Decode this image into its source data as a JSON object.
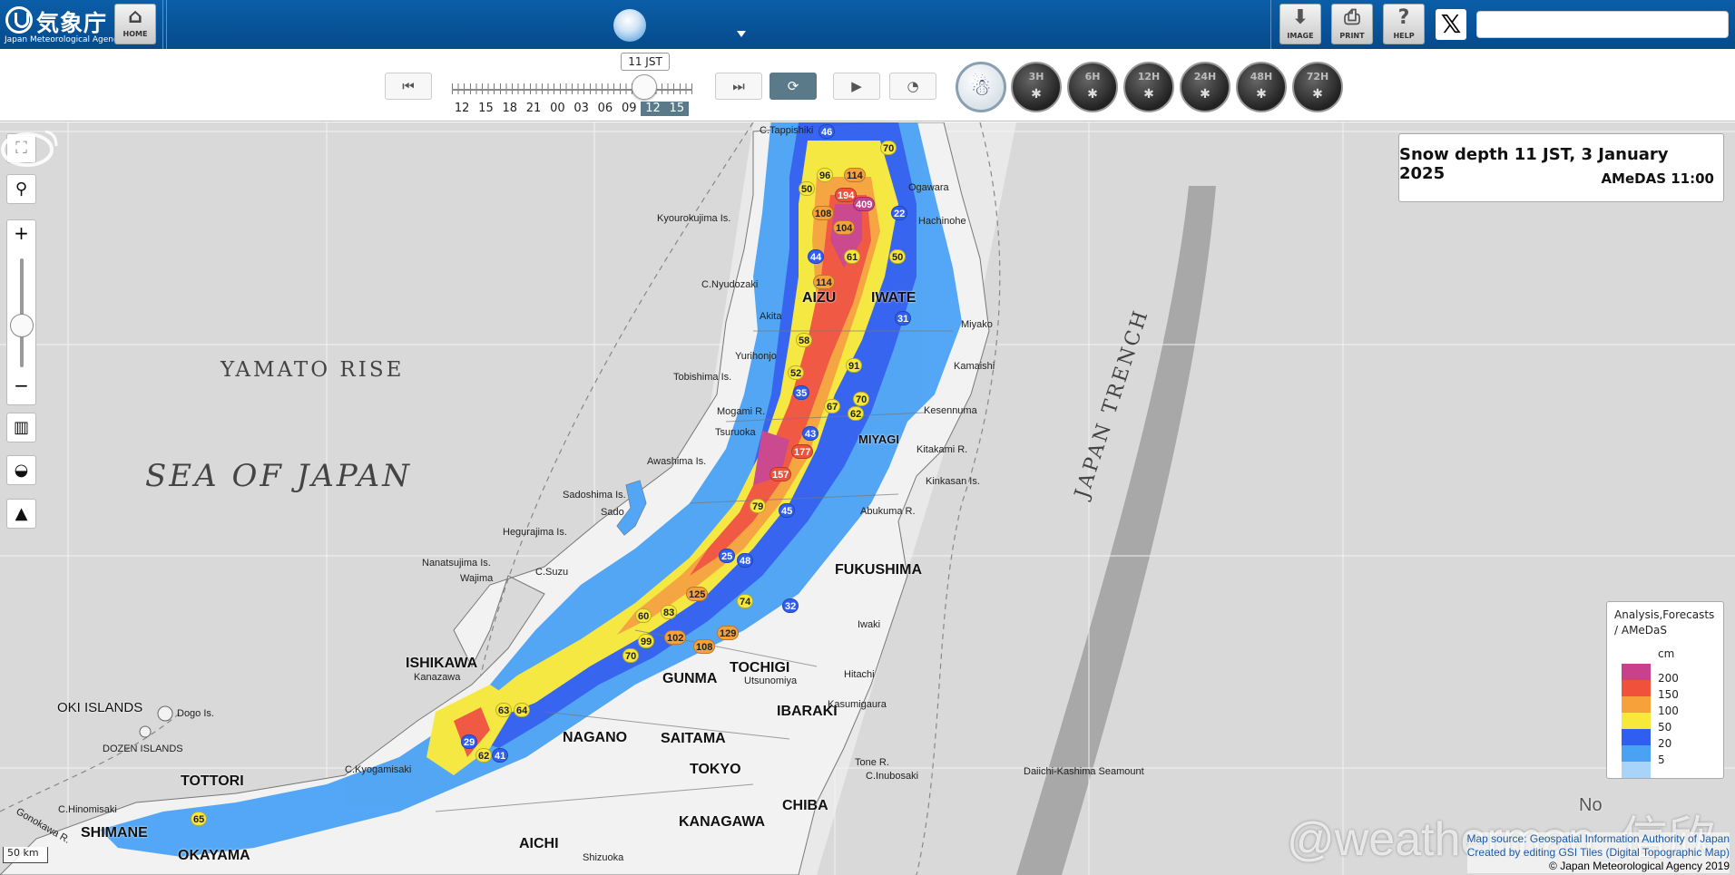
{
  "header": {
    "logo_jp": "気象庁",
    "logo_en": "Japan Meteorological Agency",
    "home_label": "HOME",
    "image_label": "IMAGE",
    "print_label": "PRINT",
    "help_label": "HELP",
    "x_label": "𝕏",
    "search_value": ""
  },
  "controls": {
    "time_tooltip": "11 JST",
    "hour_labels": [
      "12",
      "15",
      "18",
      "21",
      "00",
      "03",
      "06",
      "09",
      "12",
      "15"
    ],
    "highlighted_hours": [
      8,
      9
    ],
    "period_buttons": [
      "3H",
      "6H",
      "12H",
      "24H",
      "48H",
      "72H"
    ]
  },
  "info_box": {
    "line1": "Snow depth   11 JST, 3 January 2025",
    "line2": "AMeDAS  11:00"
  },
  "legend": {
    "title_line1": "Analysis,Forecasts",
    "title_line2": "/ AMeDaS",
    "unit": "cm",
    "levels": [
      {
        "label": "200",
        "color": "#c8418a"
      },
      {
        "label": "150",
        "color": "#f0513a"
      },
      {
        "label": "100",
        "color": "#f7a13a"
      },
      {
        "label": "50",
        "color": "#f7e83a"
      },
      {
        "label": "20",
        "color": "#2f5ef0"
      },
      {
        "label": "5",
        "color": "#4aa2f5"
      },
      {
        "label": "",
        "color": "#a9d4fa"
      }
    ]
  },
  "map_labels": {
    "seas": {
      "sea_of_japan": "SEA OF JAPAN",
      "yamato_rise": "YAMATO RISE",
      "japan_trench": "JAPAN TRENCH"
    },
    "prefectures": [
      "AIZU",
      "IWATE",
      "MIYAGI",
      "FUKUSHIMA",
      "TOCHIGI",
      "IBARAKI",
      "ISHIKAWA",
      "SAITAMA",
      "TOKYO",
      "CHIBA",
      "KANAGAWA",
      "TOTTORI",
      "SHIMANE",
      "OKAYAMA",
      "AICHI",
      "GUNMA",
      "NAGANO"
    ],
    "places": [
      "C.Tappishiki",
      "Kyourokujima Is.",
      "Ogawara",
      "Hachinohe",
      "C.Nyudozaki",
      "Akita",
      "Miyako",
      "Kamaishi",
      "Yurihonjo",
      "Tobishima Is.",
      "Mogami R.",
      "Tsuruoka",
      "Kesennuma",
      "Awashima Is.",
      "Kitakami R.",
      "Kinkasan Is.",
      "Sadoshima Is.",
      "Sado",
      "Abukuma R.",
      "Hegurajima Is.",
      "Nanatsujima Is.",
      "Wajima",
      "C.Suzu",
      "Iwaki",
      "Kanazawa",
      "Hitachi",
      "Utsunomiya",
      "OKI ISLANDS",
      "Dogo Is.",
      "DOZEN ISLANDS",
      "Kasumigaura",
      "Tone R.",
      "C.Inubosaki",
      "Daiichi-Kashima Seamount",
      "C.Kyogamisaki",
      "C.Hinomisaki",
      "Shizuoka",
      "Gonokawa R.",
      "No"
    ],
    "station_values": [
      "46",
      "70",
      "96",
      "114",
      "50",
      "194",
      "409",
      "108",
      "104",
      "22",
      "44",
      "61",
      "114",
      "50",
      "31",
      "58",
      "52",
      "91",
      "35",
      "67",
      "70",
      "62",
      "43",
      "177",
      "157",
      "79",
      "45",
      "48",
      "25",
      "74",
      "125",
      "83",
      "102",
      "108",
      "60",
      "99",
      "70",
      "129",
      "32",
      "63",
      "64",
      "29",
      "62",
      "41",
      "65"
    ]
  },
  "scale": "50 km",
  "credits": {
    "line1": "Map source: Geospatial Information Authority of Japan",
    "line2": "Created by editing GSI Tiles (Digital Topographic Map)",
    "line3": "© Japan Meteorological Agency 2019"
  },
  "watermark": "@weatherman_信欣"
}
